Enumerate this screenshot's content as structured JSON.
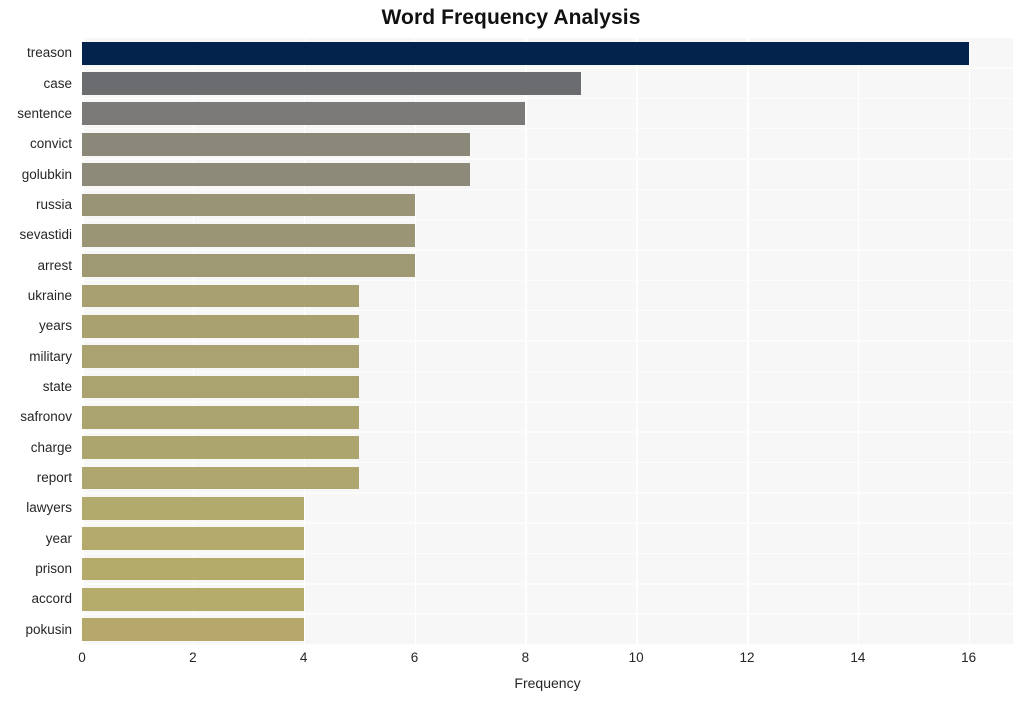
{
  "chart_data": {
    "type": "bar",
    "orientation": "horizontal",
    "title": "Word Frequency Analysis",
    "xlabel": "Frequency",
    "ylabel": "",
    "xlim": [
      0,
      16.8
    ],
    "ylim": null,
    "grid": true,
    "legend": null,
    "xticks": [
      "0",
      "2",
      "4",
      "6",
      "8",
      "10",
      "12",
      "14",
      "16"
    ],
    "xtick_values": [
      0,
      2,
      4,
      6,
      8,
      10,
      12,
      14,
      16
    ],
    "categories": [
      "treason",
      "case",
      "sentence",
      "convict",
      "golubkin",
      "russia",
      "sevastidi",
      "arrest",
      "ukraine",
      "years",
      "military",
      "state",
      "safronov",
      "charge",
      "report",
      "lawyers",
      "year",
      "prison",
      "accord",
      "pokusin"
    ],
    "values": [
      16,
      9,
      8,
      7,
      7,
      6,
      6,
      6,
      5,
      5,
      5,
      5,
      5,
      5,
      5,
      4,
      4,
      4,
      4,
      4
    ],
    "bar_colors": [
      "#03224c",
      "#6b6c70",
      "#7b7a78",
      "#8a8878",
      "#8d8a79",
      "#999476",
      "#9a9574",
      "#9e9873",
      "#a8a071",
      "#a9a170",
      "#aaa270",
      "#aba36f",
      "#aca46f",
      "#ada56e",
      "#aea66e",
      "#b2a96c",
      "#b3aa6c",
      "#b4ab6b",
      "#b5ab6b",
      "#b6a86b"
    ],
    "plot_background": "#f7f7f7",
    "gridline_color": "#ffffff",
    "figure_background": "#ffffff"
  }
}
